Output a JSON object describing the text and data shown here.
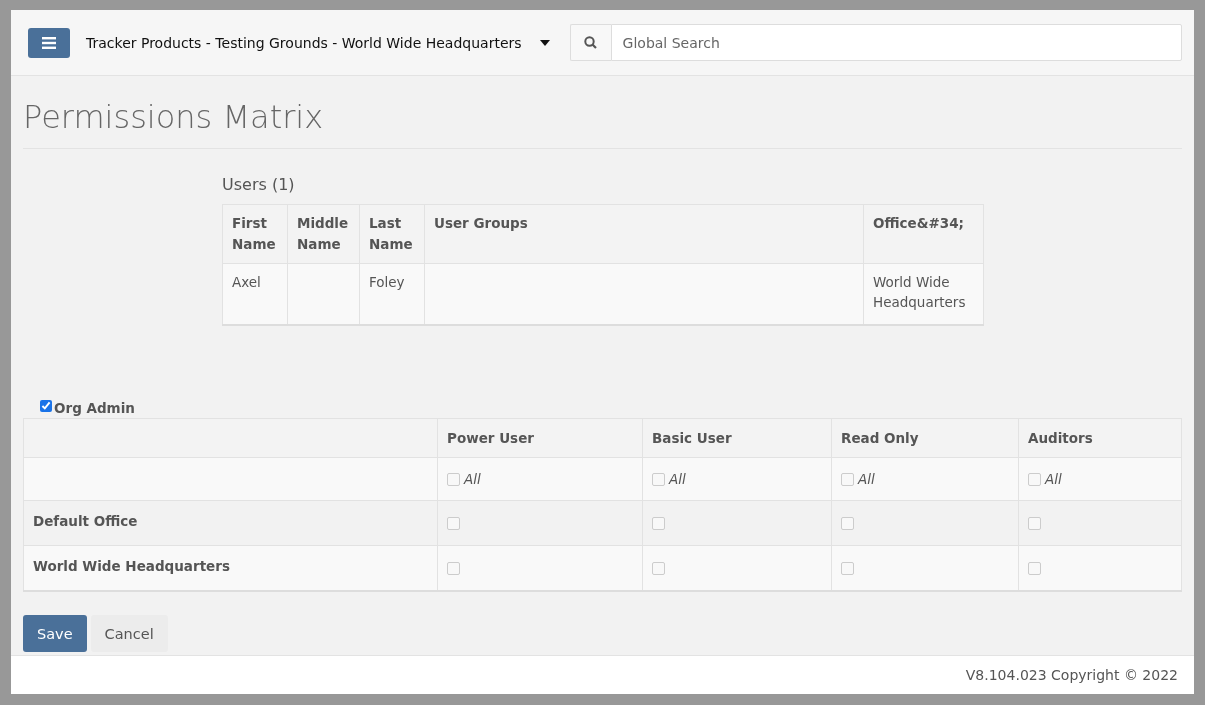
{
  "header": {
    "org_title": "Tracker Products - Testing Grounds - World Wide Headquarters",
    "search": {
      "placeholder": "Global Search"
    }
  },
  "page_title": "Permissions Matrix",
  "users": {
    "heading": "Users (1)",
    "columns": [
      "First Name",
      "Middle Name",
      "Last Name",
      "User Groups",
      "Office&#34;"
    ],
    "rows": [
      [
        "Axel",
        "",
        "Foley",
        "",
        "World Wide Headquarters"
      ]
    ]
  },
  "org_admin": {
    "label": "Org Admin",
    "checked": true
  },
  "matrix": {
    "columns": [
      "Power User",
      "Basic User",
      "Read Only",
      "Auditors"
    ],
    "select_all": [
      {
        "label": "All",
        "checked": false
      },
      {
        "label": "All",
        "checked": false
      },
      {
        "label": "All",
        "checked": false
      },
      {
        "label": "All",
        "checked": false
      }
    ],
    "rows": [
      {
        "name": "Default Office",
        "checks": [
          false,
          false,
          false,
          false
        ]
      },
      {
        "name": "World Wide Headquarters",
        "checks": [
          false,
          false,
          false,
          false
        ]
      }
    ]
  },
  "buttons": [
    {
      "kind": "primary",
      "label": "Save"
    },
    {
      "kind": "secondary",
      "label": "Cancel"
    }
  ],
  "footer": "V8.104.023 Copyright © 2022"
}
